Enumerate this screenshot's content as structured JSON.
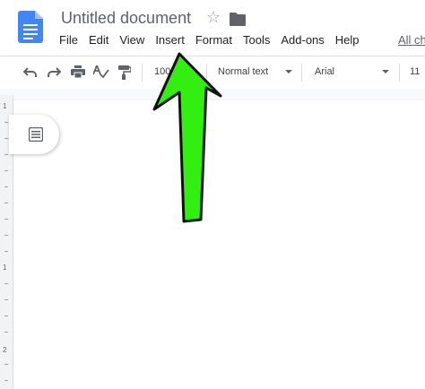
{
  "header": {
    "title": "Untitled document",
    "star_icon": "star-icon",
    "folder_icon": "folder-icon"
  },
  "menu": {
    "items": [
      "File",
      "Edit",
      "View",
      "Insert",
      "Format",
      "Tools",
      "Add-ons",
      "Help"
    ],
    "all_changes": "All ch"
  },
  "toolbar": {
    "zoom": "100%",
    "style": "Normal text",
    "font": "Arial",
    "size": "11",
    "icons": [
      "undo-icon",
      "redo-icon",
      "print-icon",
      "spellcheck-icon",
      "paint-format-icon"
    ]
  },
  "ruler": {
    "labels": [
      "1",
      "1",
      "2"
    ]
  },
  "annotation": {
    "arrow_color": "#1aff1a",
    "arrow_target": "Insert"
  },
  "colors": {
    "docs_blue": "#4285f4",
    "arrow_green": "#33ee11"
  }
}
